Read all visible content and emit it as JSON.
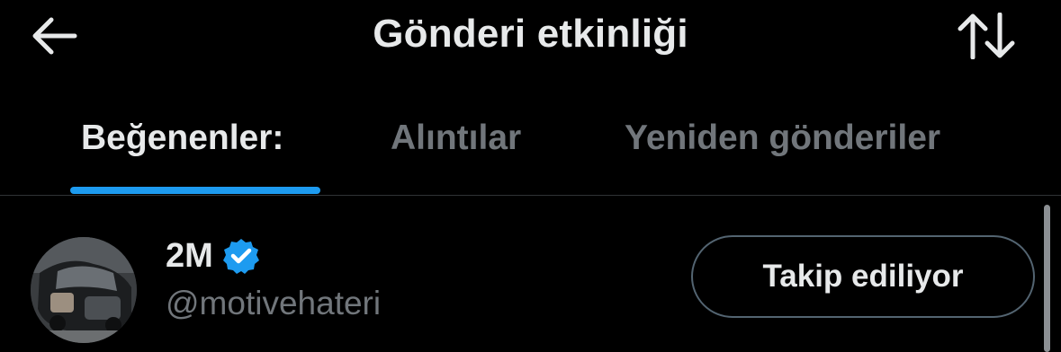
{
  "header": {
    "title": "Gönderi etkinliği",
    "back_icon": "arrow-left-icon",
    "sort_icon": "sort-arrows-icon"
  },
  "tabs": [
    {
      "label": "Beğenenler:",
      "active": true
    },
    {
      "label": "Alıntılar",
      "active": false
    },
    {
      "label": "Yeniden gönderiler",
      "active": false
    }
  ],
  "user": {
    "display_name": "2M",
    "verified_icon": "verified-badge-icon",
    "handle": "@motivehateri",
    "follow_label": "Takip ediliyor"
  },
  "colors": {
    "background": "#000000",
    "text_primary": "#e7e9ea",
    "text_secondary": "#71767b",
    "accent": "#1d9bf0",
    "divider": "#2f3336"
  }
}
